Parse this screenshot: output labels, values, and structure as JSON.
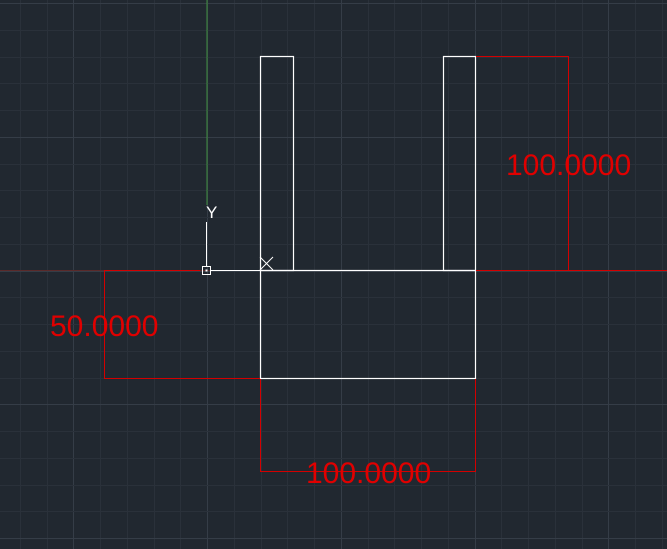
{
  "colors": {
    "background": "#212830",
    "grid_minor": "#2a313a",
    "grid_major": "#353d47",
    "geometry": "#ffffff",
    "dimension": "#e00000",
    "y_axis": "#3f8f3f",
    "x_axis": "#7a2020"
  },
  "ucs": {
    "y_label": "Y",
    "origin_icon": "ucs-origin-square-icon"
  },
  "dimensions": {
    "top_right_height": "100.0000",
    "left_height": "50.0000",
    "bottom_width": "100.0000"
  },
  "icons": {
    "snap_marker": "cross-marker-icon"
  }
}
